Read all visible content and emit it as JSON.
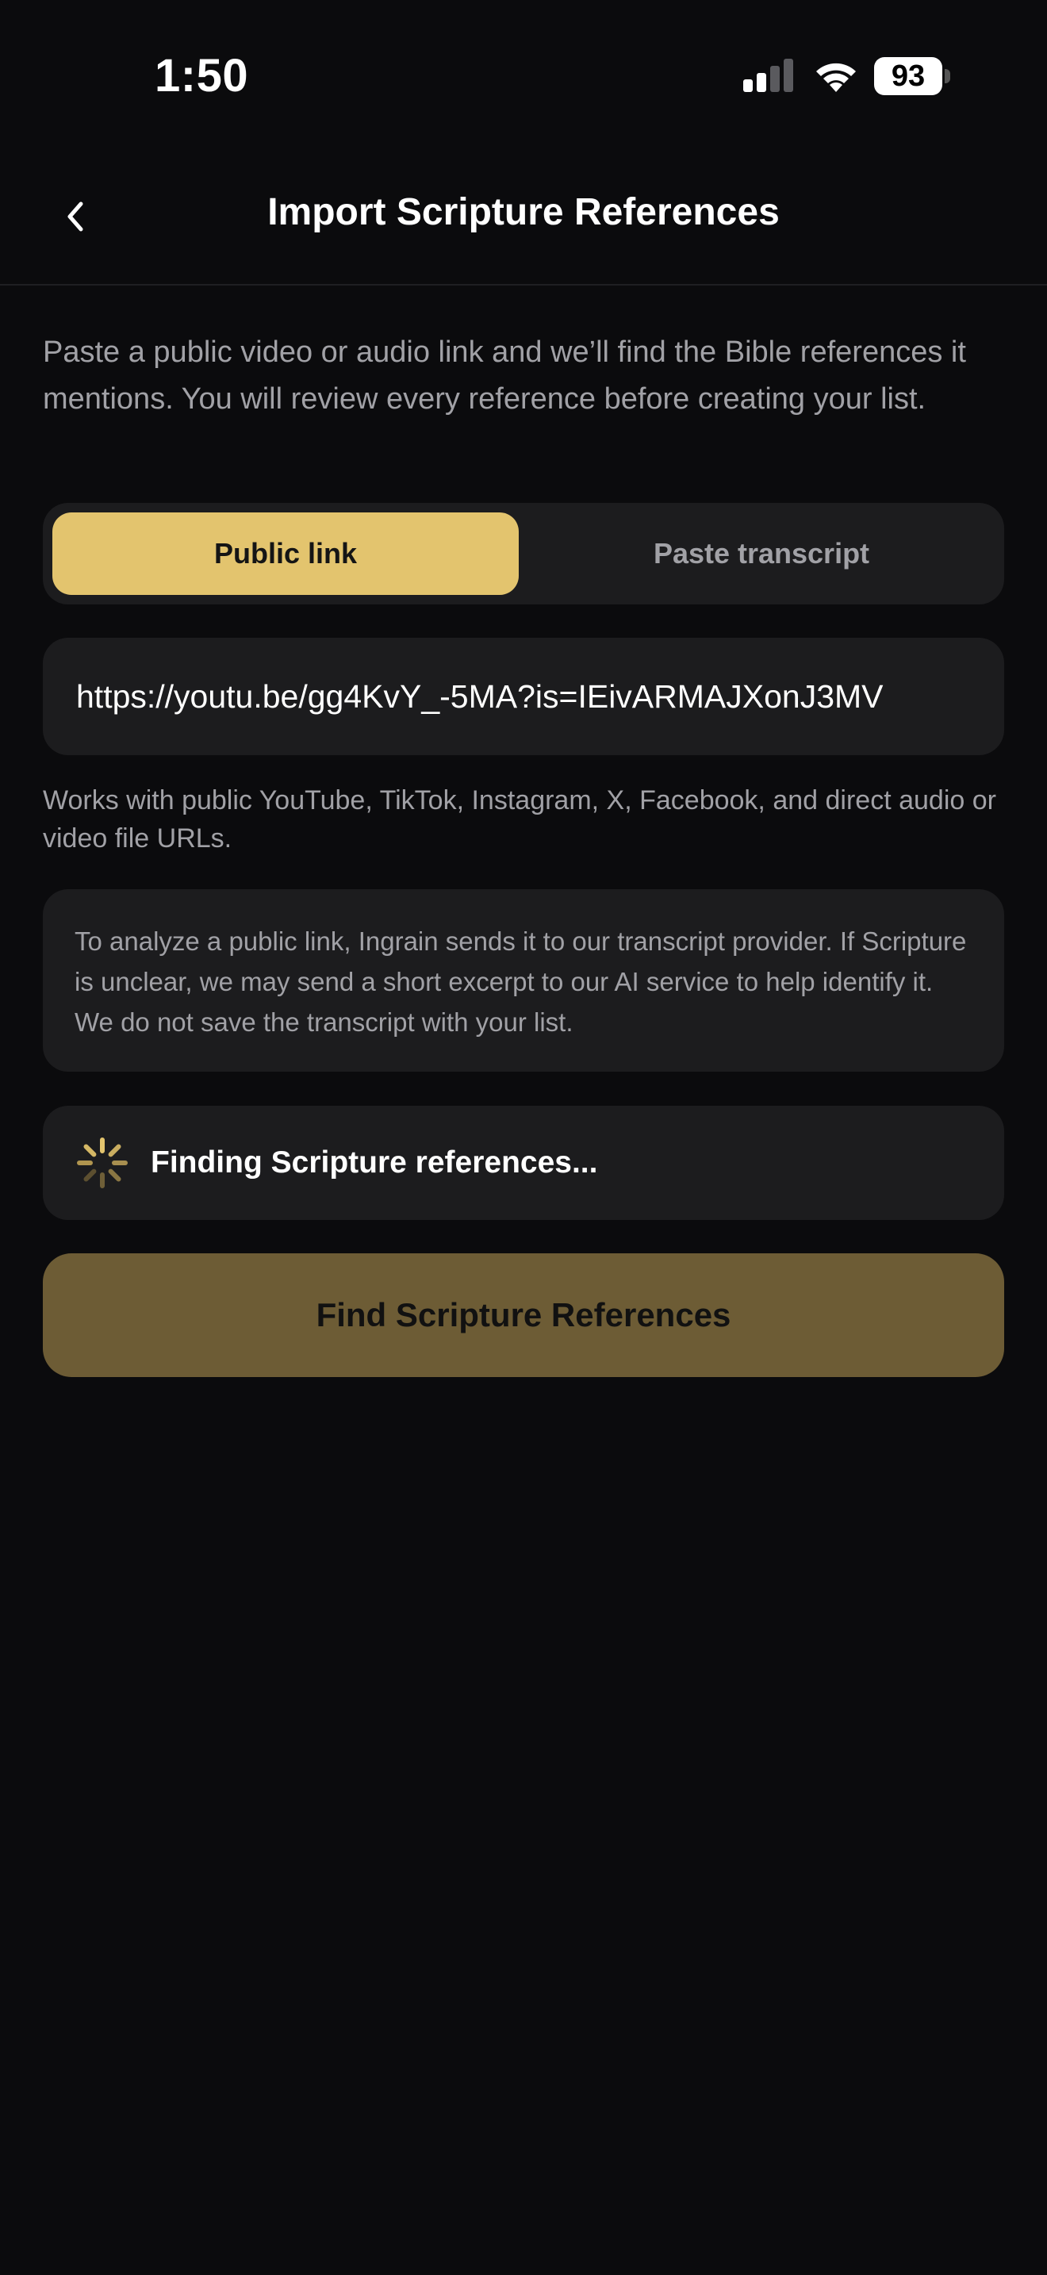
{
  "status_bar": {
    "time": "1:50",
    "battery_level": "93",
    "signal_bars": 2,
    "signal_max": 4
  },
  "nav": {
    "back_icon": "chevron-left-icon",
    "title": "Import Scripture References"
  },
  "intro_text": "Paste a public video or audio link and we’ll find the Bible references it mentions. You will review every reference before creating your list.",
  "segmented": {
    "options": [
      "Public link",
      "Paste transcript"
    ],
    "selected": "Public link"
  },
  "url_field": {
    "value": "https://youtu.be/gg4KvY_-5MA?is=IEivARMAJXonJ3MV"
  },
  "helper_text": "Works with public YouTube, TikTok, Instagram, X, Facebook, and direct audio or video file URLs.",
  "privacy_notice": "To analyze a public link, Ingrain sends it to our transcript provider. If Scripture is unclear, we may send a short excerpt to our AI service to help identify it. We do not save the transcript with your list.",
  "progress": {
    "icon": "spinner-icon",
    "text": "Finding Scripture references..."
  },
  "primary_button": {
    "label": "Find Scripture References",
    "disabled": true
  },
  "colors": {
    "background": "#0b0b0d",
    "surface": "#1c1c1e",
    "accent": "#e3c46e",
    "accent_disabled": "#6d5c35",
    "secondary_text": "#a1a1a6"
  }
}
